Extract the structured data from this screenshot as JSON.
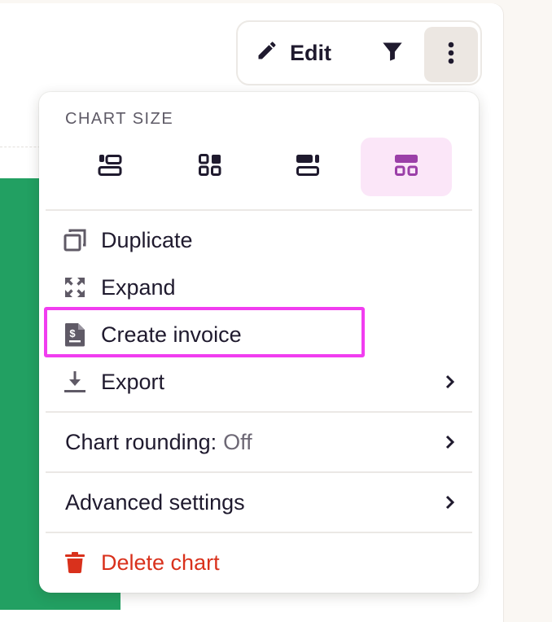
{
  "toolbar": {
    "edit_label": "Edit",
    "icons": {
      "edit": "pencil-icon",
      "filter": "filter-icon",
      "more": "kebab-menu-icon"
    }
  },
  "menu": {
    "chart_size": {
      "title": "CHART SIZE",
      "options": [
        {
          "name": "size-option-1",
          "icon": "layout-stacked-left-icon",
          "selected": false
        },
        {
          "name": "size-option-2",
          "icon": "layout-grid-icon",
          "selected": false
        },
        {
          "name": "size-option-3",
          "icon": "layout-stacked-right-icon",
          "selected": false
        },
        {
          "name": "size-option-4",
          "icon": "layout-wide-icon",
          "selected": true
        }
      ]
    },
    "actions": {
      "duplicate": "Duplicate",
      "expand": "Expand",
      "create_invoice": "Create invoice",
      "export": "Export"
    },
    "chart_rounding": {
      "label": "Chart rounding:",
      "value": "Off"
    },
    "advanced_settings": "Advanced settings",
    "delete_chart": "Delete chart"
  },
  "colors": {
    "accent": "#9b3fa8",
    "highlight": "#f13df0",
    "danger": "#d9311c",
    "green": "#22a062"
  }
}
